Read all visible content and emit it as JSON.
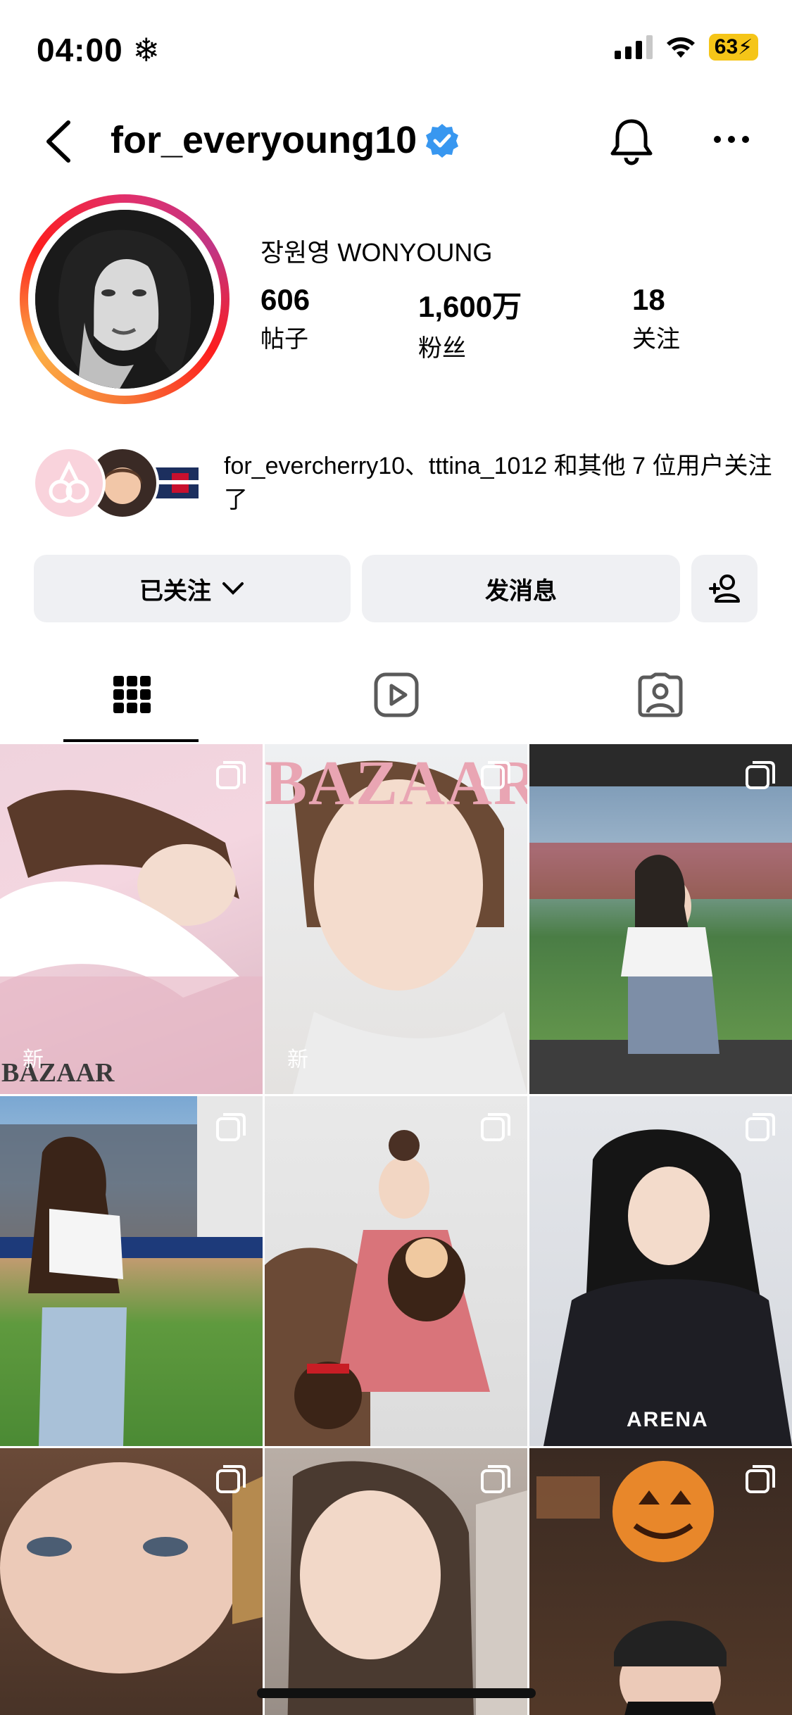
{
  "status": {
    "time": "04:00",
    "battery": "63"
  },
  "header": {
    "username": "for_everyoung10"
  },
  "profile": {
    "display_name": "장원영 WONYOUNG",
    "stats": [
      {
        "value": "606",
        "label": "帖子"
      },
      {
        "value": "1,600万",
        "label": "粉丝"
      },
      {
        "value": "18",
        "label": "关注"
      }
    ]
  },
  "followed_by": {
    "text": "for_evercherry10、tttina_1012 和其他 7 位用户关注了"
  },
  "actions": {
    "follow_label": "已关注",
    "message_label": "发消息"
  },
  "grid": {
    "items": [
      {
        "badge": "新",
        "mark": "BAZAAR"
      },
      {
        "badge": "新",
        "mark": "BAZAAR"
      },
      {
        "badge": "",
        "mark": ""
      },
      {
        "badge": "",
        "mark": ""
      },
      {
        "badge": "",
        "mark": ""
      },
      {
        "badge": "",
        "mark": "ARENA"
      },
      {
        "badge": "",
        "mark": ""
      },
      {
        "badge": "",
        "mark": ""
      },
      {
        "badge": "",
        "mark": ""
      }
    ]
  },
  "colors": {
    "verified": "#3897f0",
    "button_bg": "#eff0f3"
  }
}
